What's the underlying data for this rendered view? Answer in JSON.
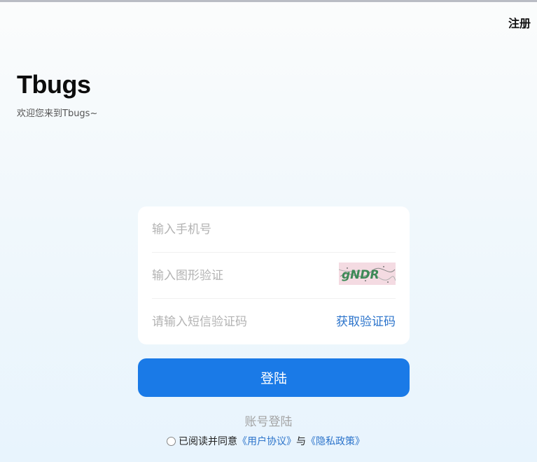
{
  "header": {
    "register_label": "注册"
  },
  "brand": {
    "title": "Tbugs",
    "subtitle": "欢迎您来到Tbugs~"
  },
  "form": {
    "phone_placeholder": "输入手机号",
    "captcha_placeholder": "输入图形验证",
    "captcha_text": "gNDR",
    "sms_placeholder": "请输入短信验证码",
    "sms_button": "获取验证码"
  },
  "login_button": "登陆",
  "account_login": "账号登陆",
  "agreement": {
    "prefix": "已阅读并同意",
    "user_agreement": "《用户协议》",
    "conjunction": "与",
    "privacy_policy": "《隐私政策》"
  },
  "colors": {
    "accent": "#1a7ae7",
    "link": "#2c74cb",
    "placeholder": "#b3b3b3"
  }
}
